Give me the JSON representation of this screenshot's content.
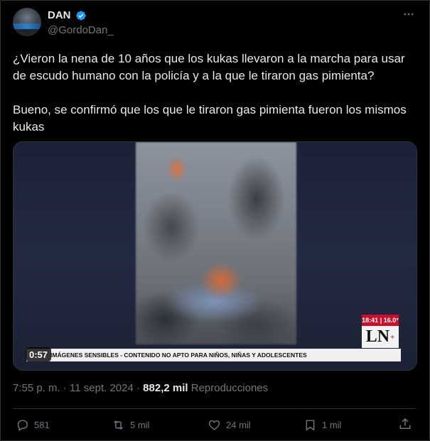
{
  "author": {
    "name": "DAN",
    "handle": "@GordoDan_",
    "verified_color": "#1d9bf0"
  },
  "tweet": {
    "paragraphs": [
      "¿Vieron la nena de 10 años que los kukas llevaron a la marcha para usar de escudo humano con la policía y a la que le tiraron gas pimienta?",
      "Bueno, se confirmó que los que le tiraron gas pimienta fueron los mismos kukas"
    ]
  },
  "media": {
    "duration": "0:57",
    "channel_time": "18:41 | 16.0°",
    "channel_logo": "LN",
    "channel_logo_sup": "+",
    "banner_text": "IMÁGENES SENSIBLES - CONTENIDO NO APTO PARA NIÑOS, NIÑAS Y ADOLESCENTES"
  },
  "meta": {
    "timestamp": "7:55 p. m. · 11 sept. 2024 · ",
    "views": "882,2 mil",
    "views_label": " Reproducciones"
  },
  "actions": {
    "replies": "581",
    "reposts": "5 mil",
    "likes": "24 mil",
    "bookmarks": "1 mil"
  },
  "icons": {
    "more": "more-icon",
    "reply": "reply-icon",
    "repost": "repost-icon",
    "like": "heart-icon",
    "bookmark": "bookmark-icon",
    "share": "share-icon",
    "verified": "verified-badge-icon"
  },
  "colors": {
    "background": "#000000",
    "text_primary": "#e7e9ea",
    "text_secondary": "#71767b",
    "border": "#2f3336"
  }
}
